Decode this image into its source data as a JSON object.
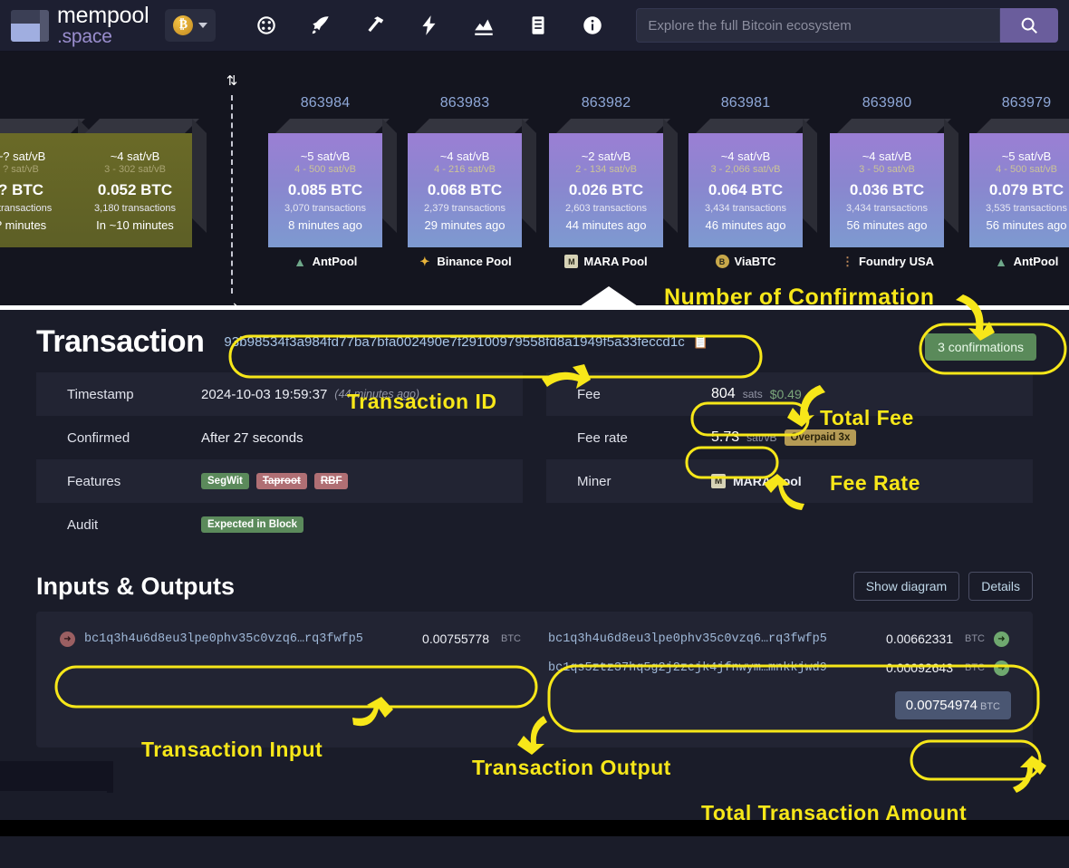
{
  "nav": {
    "brand_line1": "mempool",
    "brand_line2": ".space",
    "coin_symbol": "₿",
    "icons": [
      {
        "name": "dashboard-icon",
        "label": "Dashboard"
      },
      {
        "name": "rocket-icon",
        "label": "Accelerator"
      },
      {
        "name": "mining-icon",
        "label": "Mining"
      },
      {
        "name": "lightning-icon",
        "label": "Lightning"
      },
      {
        "name": "graphs-icon",
        "label": "Graphs"
      },
      {
        "name": "docs-icon",
        "label": "Docs"
      },
      {
        "name": "info-icon",
        "label": "About"
      }
    ],
    "search_placeholder": "Explore the full Bitcoin ecosystem",
    "search_value": ""
  },
  "chain": {
    "mempool_blocks": [
      {
        "rate": "~? sat/vB",
        "range": "? sat/vB",
        "btc": "? BTC",
        "txs": "? transactions",
        "time": "? minutes",
        "partial": true
      },
      {
        "rate": "~4 sat/vB",
        "range": "3 - 302 sat/vB",
        "btc": "0.052 BTC",
        "txs": "3,180 transactions",
        "time": "In ~10 minutes",
        "partial": false
      }
    ],
    "blocks": [
      {
        "height": "863984",
        "rate": "~5 sat/vB",
        "range": "4 - 500 sat/vB",
        "btc": "0.085 BTC",
        "txs": "3,070 transactions",
        "time": "8 minutes ago",
        "pool": "AntPool",
        "pool_icon": "antpool-icon"
      },
      {
        "height": "863983",
        "rate": "~4 sat/vB",
        "range": "4 - 216 sat/vB",
        "btc": "0.068 BTC",
        "txs": "2,379 transactions",
        "time": "29 minutes ago",
        "pool": "Binance Pool",
        "pool_icon": "binance-icon"
      },
      {
        "height": "863982",
        "rate": "~2 sat/vB",
        "range": "2 - 134 sat/vB",
        "btc": "0.026 BTC",
        "txs": "2,603 transactions",
        "time": "44 minutes ago",
        "pool": "MARA Pool",
        "pool_icon": "mara-icon"
      },
      {
        "height": "863981",
        "rate": "~4 sat/vB",
        "range": "3 - 2,066 sat/vB",
        "btc": "0.064 BTC",
        "txs": "3,434 transactions",
        "time": "46 minutes ago",
        "pool": "ViaBTC",
        "pool_icon": "viabtc-icon"
      },
      {
        "height": "863980",
        "rate": "~4 sat/vB",
        "range": "3 - 50 sat/vB",
        "btc": "0.036 BTC",
        "txs": "3,434 transactions",
        "time": "56 minutes ago",
        "pool": "Foundry USA",
        "pool_icon": "foundry-icon"
      },
      {
        "height": "863979",
        "rate": "~5 sat/vB",
        "range": "4 - 500 sat/vB",
        "btc": "0.079 BTC",
        "txs": "3,535 transactions",
        "time": "56 minutes ago",
        "pool": "AntPool",
        "pool_icon": "antpool-icon"
      }
    ]
  },
  "transaction": {
    "title": "Transaction",
    "txid": "93b98534f3a984fd77ba7bfa002490e7f29100979558fd8a1949f5a33feccd1c",
    "confirmations": "3 confirmations",
    "left_rows": [
      {
        "label": "Timestamp",
        "value": "2024-10-03 19:59:37",
        "muted": "(44 minutes ago)"
      },
      {
        "label": "Confirmed",
        "value": "After 27 seconds",
        "muted": ""
      },
      {
        "label": "Features",
        "badges": [
          {
            "text": "SegWit",
            "style": "green"
          },
          {
            "text": "Taproot",
            "style": "red"
          },
          {
            "text": "RBF",
            "style": "red"
          }
        ]
      },
      {
        "label": "Audit",
        "badges": [
          {
            "text": "Expected in Block",
            "style": "green"
          }
        ]
      }
    ],
    "right_rows": [
      {
        "label": "Fee",
        "amount": "804",
        "unit": "sats",
        "usd": "$0.49"
      },
      {
        "label": "Fee rate",
        "amount": "5.73",
        "unit": "sat/vB",
        "badge": "Overpaid 3x"
      },
      {
        "label": "Miner",
        "miner": "MARA Pool",
        "miner_icon": "mara-icon"
      }
    ]
  },
  "io": {
    "title": "Inputs & Outputs",
    "show_diagram_label": "Show diagram",
    "details_label": "Details",
    "inputs": [
      {
        "address": "bc1q3h4u6d8eu3lpe0phv35c0vzq6…rq3fwfp5",
        "amount": "0.00755778",
        "unit": "BTC"
      }
    ],
    "outputs": [
      {
        "address": "bc1q3h4u6d8eu3lpe0phv35c0vzq6…rq3fwfp5",
        "amount": "0.00662331",
        "unit": "BTC"
      },
      {
        "address": "bc1qs5ztz37hq5g2j2zejk4jfnwym…mnkkjwd9",
        "amount": "0.00092643",
        "unit": "BTC"
      }
    ],
    "total": "0.00754974",
    "total_unit": "BTC"
  },
  "annotations": {
    "confirmation": "Number of Confirmation",
    "txid": "Transaction ID",
    "total_fee": "Total Fee",
    "fee_rate": "Fee Rate",
    "tx_input": "Transaction Input",
    "tx_output": "Transaction Output",
    "total_amount": "Total Transaction Amount"
  },
  "colors": {
    "annotation_yellow": "#f7e719",
    "accent_purple": "#6a5d9c",
    "confirm_green": "#5a8a5a",
    "page_bg": "#1a1c29",
    "chain_bg": "#14151f"
  }
}
